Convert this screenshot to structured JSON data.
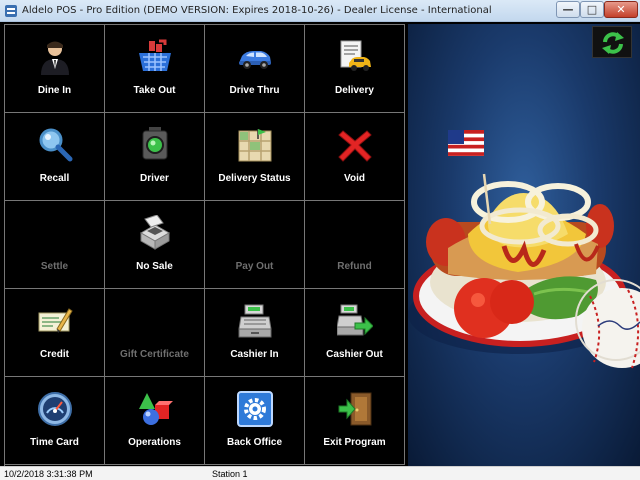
{
  "window": {
    "title": "Aldelo POS - Pro Edition (DEMO VERSION: Expires 2018-10-26) - Dealer License - International",
    "minimize_glyph": "—",
    "maximize_glyph": "□",
    "close_glyph": "✕"
  },
  "tiles": [
    {
      "label": "Dine In",
      "icon": "waiter-icon",
      "enabled": true
    },
    {
      "label": "Take Out",
      "icon": "shopping-basket-icon",
      "enabled": true
    },
    {
      "label": "Drive Thru",
      "icon": "car-icon",
      "enabled": true
    },
    {
      "label": "Delivery",
      "icon": "delivery-icon",
      "enabled": true
    },
    {
      "label": "Recall",
      "icon": "magnifier-icon",
      "enabled": true
    },
    {
      "label": "Driver",
      "icon": "traffic-light-icon",
      "enabled": true
    },
    {
      "label": "Delivery Status",
      "icon": "map-icon",
      "enabled": true
    },
    {
      "label": "Void",
      "icon": "x-icon",
      "enabled": true
    },
    {
      "label": "Settle",
      "icon": "",
      "enabled": false
    },
    {
      "label": "No Sale",
      "icon": "cash-drawer-icon",
      "enabled": true
    },
    {
      "label": "Pay Out",
      "icon": "",
      "enabled": false
    },
    {
      "label": "Refund",
      "icon": "",
      "enabled": false
    },
    {
      "label": "Credit",
      "icon": "credit-slip-icon",
      "enabled": true
    },
    {
      "label": "Gift Certificate",
      "icon": "",
      "enabled": false
    },
    {
      "label": "Cashier In",
      "icon": "cash-register-icon",
      "enabled": true
    },
    {
      "label": "Cashier Out",
      "icon": "cash-register-out-icon",
      "enabled": true
    },
    {
      "label": "Time Card",
      "icon": "gauge-icon",
      "enabled": true
    },
    {
      "label": "Operations",
      "icon": "shapes-icon",
      "enabled": true
    },
    {
      "label": "Back Office",
      "icon": "gear-icon",
      "enabled": true
    },
    {
      "label": "Exit Program",
      "icon": "exit-door-icon",
      "enabled": true
    }
  ],
  "status": {
    "datetime": "10/2/2018 3:31:38 PM",
    "station": "Station 1"
  },
  "colors": {
    "tile_bg": "#000000",
    "tile_border": "#777777",
    "label_enabled": "#ffffff",
    "label_disabled": "#6f6f6f",
    "photo_bg": "#1a3a6b"
  }
}
